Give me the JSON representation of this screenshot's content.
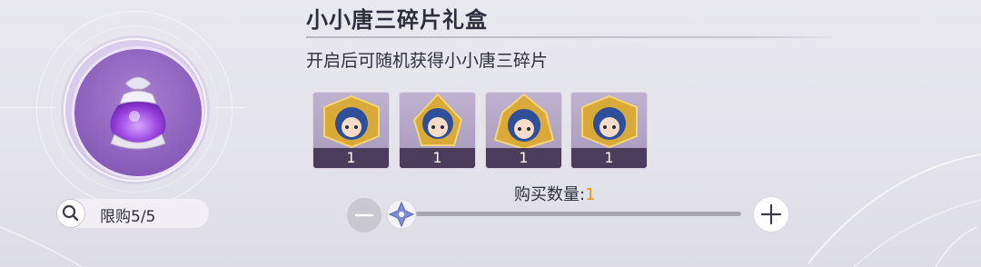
{
  "item": {
    "title": "小小唐三碎片礼盒",
    "description": "开启后可随机获得小小唐三碎片",
    "icon": "purple-gift-pouch-icon"
  },
  "limit": {
    "text": "限购5/5",
    "icon": "search-icon"
  },
  "rewards": [
    {
      "icon": "tang-san-fragment-icon",
      "count": "1"
    },
    {
      "icon": "tang-san-fragment-icon",
      "count": "1"
    },
    {
      "icon": "tang-san-fragment-icon",
      "count": "1"
    },
    {
      "icon": "tang-san-fragment-icon",
      "count": "1"
    }
  ],
  "quantity": {
    "label": "购买数量:",
    "value": "1",
    "value_color": "#e09a1c",
    "slider_position": 0
  },
  "colors": {
    "accent_purple": "#8c62bd",
    "reward_count_bar": "#4a3c5a"
  }
}
